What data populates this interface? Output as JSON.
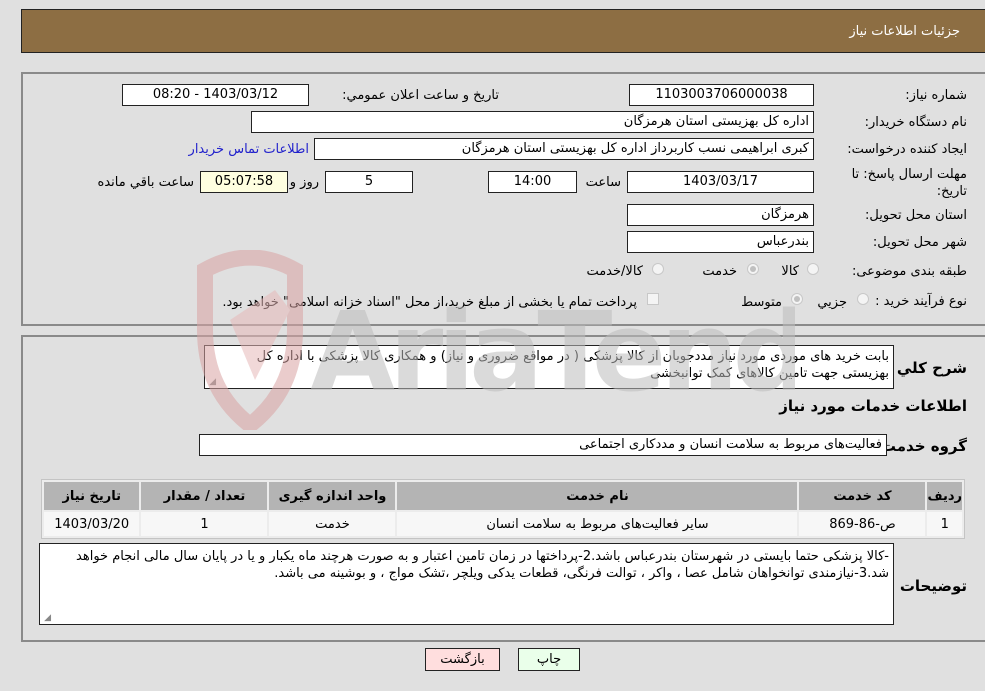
{
  "header": {
    "title": "جزئیات اطلاعات نیاز"
  },
  "info": {
    "need_number_label": "شماره نیاز:",
    "need_number": "1103003706000038",
    "announce_label": "تاريخ و ساعت اعلان عمومي:",
    "announce_value": "1403/03/12 - 08:20",
    "buyer_org_label": "نام دستگاه خریدار:",
    "buyer_org": "اداره کل بهزیستی استان هرمزگان",
    "creator_label": "ایجاد کننده درخواست:",
    "creator": "کبری  ابراهیمی نسب کاربرداز اداره کل بهزیستی استان هرمزگان",
    "contact_link": "اطلاعات تماس خریدار",
    "deadline_label": "مهلت ارسال پاسخ: تا تاریخ:",
    "deadline_date": "1403/03/17",
    "time_label": "ساعت",
    "deadline_time": "14:00",
    "days_value": "5",
    "days_label": "روز و",
    "remaining_time": "05:07:58",
    "remaining_label": "ساعت باقي مانده",
    "province_label": "استان محل تحویل:",
    "province": "هرمزگان",
    "city_label": "شهر محل تحویل:",
    "city": "بندرعباس",
    "category_label": "طبقه بندی موضوعی:",
    "category_options": [
      {
        "label": "کالا",
        "checked": false
      },
      {
        "label": "خدمت",
        "checked": true
      },
      {
        "label": "کالا/خدمت",
        "checked": false
      }
    ],
    "process_label": "نوع فرآیند خرید :",
    "process_options": [
      {
        "label": "جزيي",
        "checked": false
      },
      {
        "label": "متوسط",
        "checked": true
      }
    ],
    "treasury_note": "پرداخت تمام یا بخشی از مبلغ خرید،از محل \"اسناد خزانه اسلامی\" خواهد بود."
  },
  "details": {
    "description_label": "شرح كلي نياز:",
    "description": "بابت خرید های موردی مورد نیاز مددجویان از کالا پزشکی ( در مواقع ضروری و نیاز) و همکاری کالا پزشکی با اداره کل بهزیستی جهت تامین کالاهای کمک توانبخشی",
    "services_heading": "اطلاعات خدمات مورد نیاز",
    "service_group_label": "گروه خدمت:",
    "service_group": "فعالیت‌های مربوط به سلامت انسان و مددکاری اجتماعی",
    "table": {
      "headers": [
        "ردیف",
        "کد خدمت",
        "نام خدمت",
        "واحد اندازه گیری",
        "تعداد / مقدار",
        "تاریخ نیاز"
      ],
      "rows": [
        [
          "1",
          "ص-86-869",
          "سایر فعالیت‌های مربوط به سلامت انسان",
          "خدمت",
          "1",
          "1403/03/20"
        ]
      ]
    },
    "buyer_notes_label": "توضیحات خریدار:",
    "buyer_notes": "-کالا پزشکی حتما بایستی در شهرستان بندرعباس باشد.2-پرداختها در زمان تامین اعتبار و به صورت هرچند ماه یکبار و یا در پایان سال مالی انجام خواهد شد.3-نیازمندی توانخواهان شامل عصا ، واکر ، توالت فرنگی، قطعات یدکی ویلچر ،تشک مواج ، و بوشینه می باشد."
  },
  "buttons": {
    "print": "چاپ",
    "back": "بازگشت"
  },
  "watermark": {
    "text": "AriaTender.neT"
  }
}
